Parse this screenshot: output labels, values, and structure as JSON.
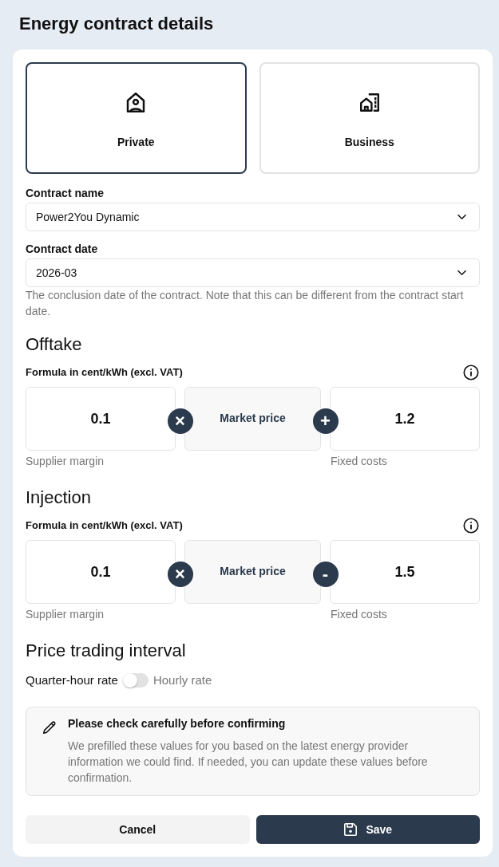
{
  "title": "Energy contract details",
  "customer_types": [
    {
      "label": "Private",
      "kind": "private",
      "selected": true
    },
    {
      "label": "Business",
      "kind": "business",
      "selected": false
    }
  ],
  "contract_name": {
    "label": "Contract name",
    "value": "Power2You Dynamic"
  },
  "contract_date": {
    "label": "Contract date",
    "value": "2026-03",
    "help": "The conclusion date of the contract. Note that this can be different from the contract start date."
  },
  "formulas": [
    {
      "heading": "Offtake",
      "label": "Formula in cent/kWh (excl. VAT)",
      "margin": {
        "value": "0.1",
        "caption": "Supplier margin"
      },
      "operator_1": "×",
      "market_price": "Market price",
      "operator_2": "+",
      "fixed_costs": {
        "value": "1.2",
        "caption": "Fixed costs"
      }
    },
    {
      "heading": "Injection",
      "label": "Formula in cent/kWh (excl. VAT)",
      "margin": {
        "value": "0.1",
        "caption": "Supplier margin"
      },
      "operator_1": "×",
      "market_price": "Market price",
      "operator_2": "-",
      "fixed_costs": {
        "value": "1.5",
        "caption": "Fixed costs"
      }
    }
  ],
  "trading_interval": {
    "heading": "Price trading interval",
    "left_label": "Quarter-hour rate",
    "right_label": "Hourly rate",
    "on": false
  },
  "notice": {
    "title": "Please check carefully before confirming",
    "body": "We prefilled these values for you based on the latest energy provider information we could find. If needed, you can update these values before confirmation."
  },
  "buttons": [
    {
      "label": "Cancel",
      "kind": "secondary"
    },
    {
      "label": "Save",
      "kind": "primary"
    }
  ]
}
